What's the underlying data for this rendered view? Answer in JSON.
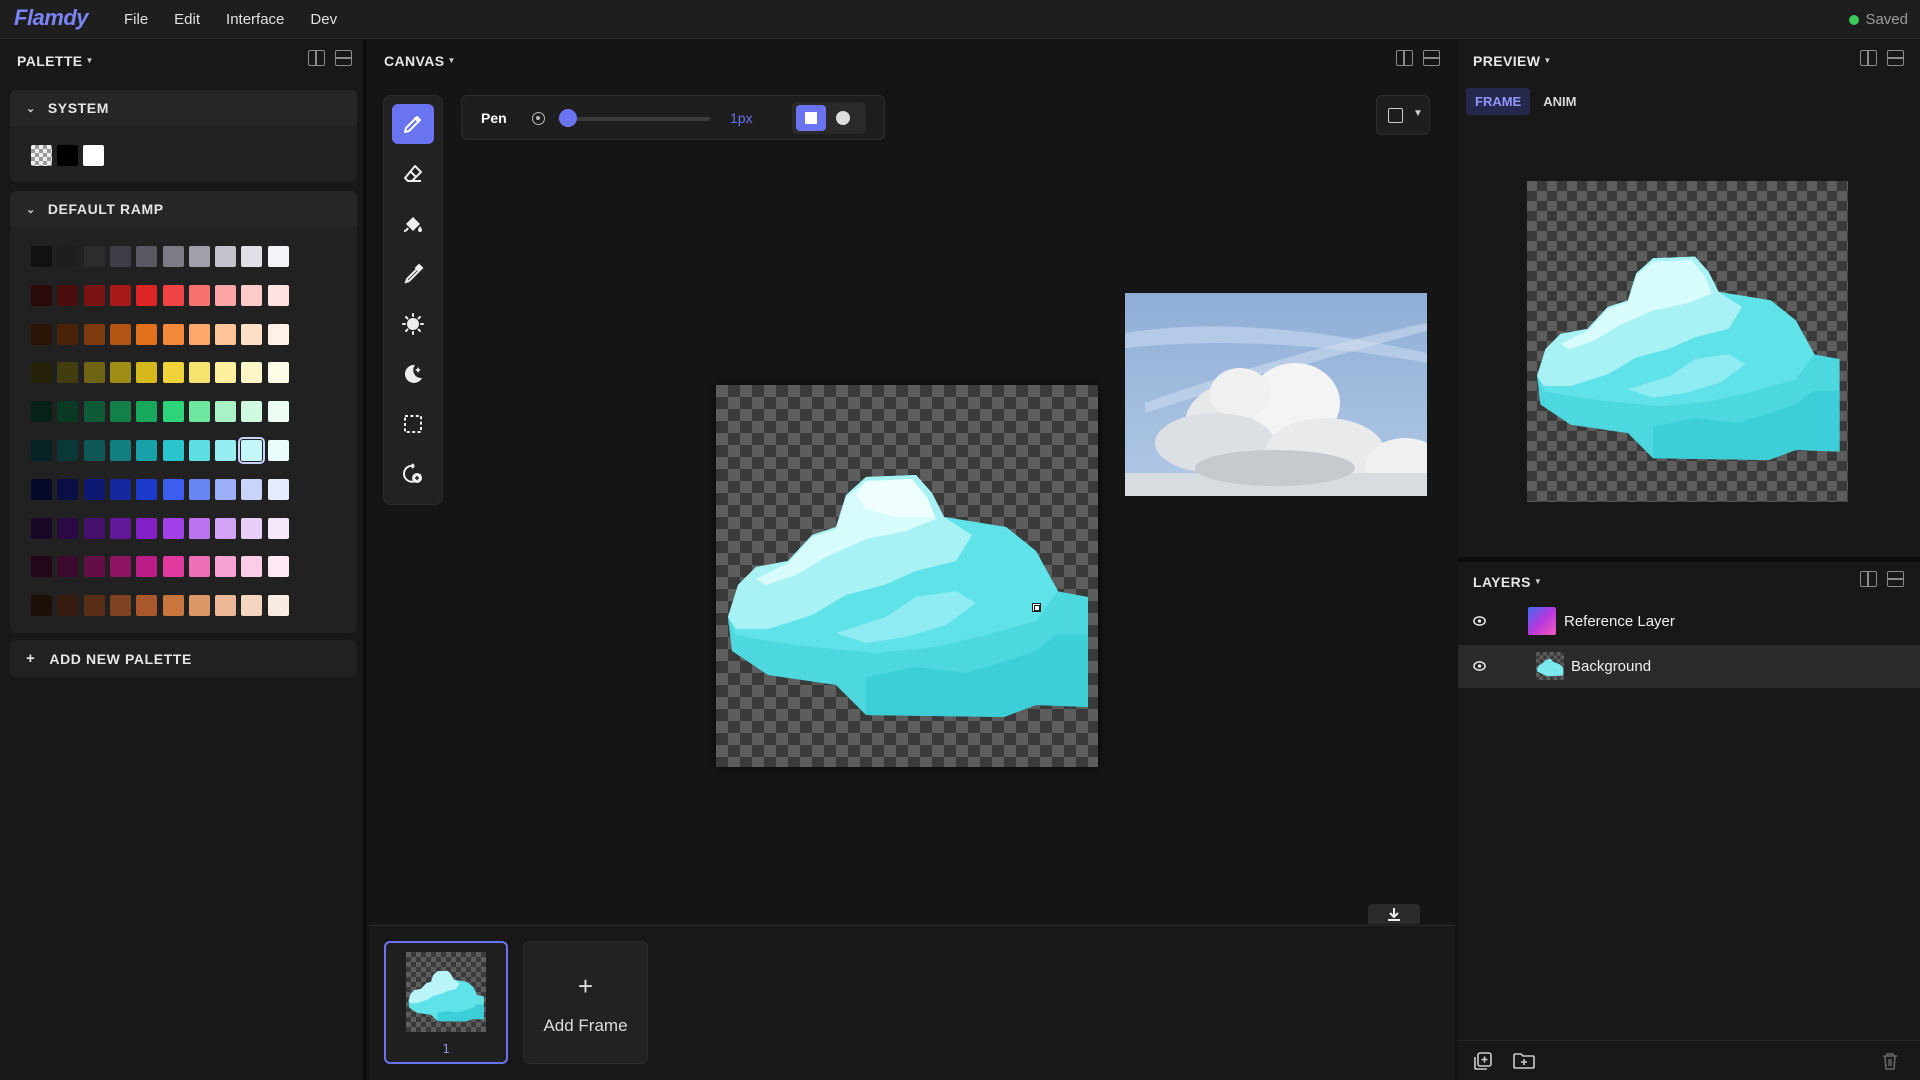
{
  "app": {
    "logo": "Flamdy",
    "menu": [
      "File",
      "Edit",
      "Interface",
      "Dev"
    ],
    "status": "Saved",
    "status_color": "#3bc95a",
    "accent": "#6a74f0"
  },
  "palette_panel": {
    "title": "PALETTE",
    "system": {
      "title": "SYSTEM",
      "colors": [
        "transparent",
        "#000000",
        "#ffffff"
      ]
    },
    "default_ramp": {
      "title": "DEFAULT RAMP",
      "selected": {
        "row": 5,
        "col": 8
      },
      "rows": [
        [
          "#111111",
          "#1e1e1e",
          "#2c2c2c",
          "#3e3e46",
          "#585862",
          "#7c7c86",
          "#a0a0aa",
          "#c2c2cc",
          "#e0e0e8",
          "#f4f4f8"
        ],
        [
          "#2a0a0a",
          "#4a0e0e",
          "#7a1414",
          "#a81a1a",
          "#dc2626",
          "#ef4444",
          "#f87171",
          "#fca5a5",
          "#fecaca",
          "#fee2e2"
        ],
        [
          "#2a1406",
          "#4a2208",
          "#7c3a0e",
          "#b35412",
          "#e0701a",
          "#f5893a",
          "#fba86a",
          "#fdc49a",
          "#fde0c8",
          "#fff1e6"
        ],
        [
          "#26220a",
          "#423c0e",
          "#6e6414",
          "#9e8e18",
          "#d4b81c",
          "#f0d23a",
          "#f8e270",
          "#fcef9e",
          "#fdf6c8",
          "#fefbe6"
        ],
        [
          "#062216",
          "#0a3a24",
          "#0e5a36",
          "#128048",
          "#16a95c",
          "#2ed47a",
          "#6ee7a0",
          "#a7f3c5",
          "#cffae0",
          "#ecfdf3"
        ],
        [
          "#062222",
          "#0a3838",
          "#0e5858",
          "#127e7e",
          "#16a2a8",
          "#28c6cc",
          "#5edde2",
          "#96eef0",
          "#c4f7f8",
          "#e8fcfc"
        ],
        [
          "#06082a",
          "#0a1046",
          "#0e1a72",
          "#1428a0",
          "#1c3acc",
          "#3c5ef0",
          "#6a86f5",
          "#9cb0fa",
          "#c8d4fc",
          "#e6ecfe"
        ],
        [
          "#180626",
          "#2a0a42",
          "#44106c",
          "#621698",
          "#8220c6",
          "#a040e6",
          "#bc72f0",
          "#d4a2f6",
          "#e8cdfa",
          "#f5e8fd"
        ],
        [
          "#22061a",
          "#3c0a2c",
          "#640e48",
          "#8e1466",
          "#bc1c86",
          "#e03a9e",
          "#ee6eb8",
          "#f6a2d2",
          "#fbcde6",
          "#fde8f4"
        ],
        [
          "#1e1008",
          "#361c0e",
          "#582e16",
          "#7e4220",
          "#a8582c",
          "#c8763e",
          "#dc9866",
          "#eab896",
          "#f4d6c0",
          "#fbece2"
        ]
      ]
    },
    "add_label": "ADD NEW PALETTE"
  },
  "canvas_panel": {
    "title": "CANVAS",
    "tools": [
      "pencil-icon",
      "eraser-icon",
      "fill-bucket-icon",
      "eyedropper-icon",
      "lighten-icon",
      "darken-icon",
      "selection-icon",
      "replace-color-icon"
    ],
    "active_tool": "pencil-icon",
    "tool_options": {
      "name": "Pen",
      "size_value": "1px",
      "brush_shape": "square"
    }
  },
  "timeline": {
    "frames": [
      {
        "number": "1"
      }
    ],
    "add_frame_label": "Add Frame"
  },
  "preview_panel": {
    "title": "PREVIEW",
    "tabs": [
      "FRAME",
      "ANIM"
    ],
    "active_tab": "FRAME"
  },
  "layers_panel": {
    "title": "LAYERS",
    "layers": [
      {
        "name": "Reference Layer",
        "visible": true,
        "selected": false
      },
      {
        "name": "Background",
        "visible": true,
        "selected": true
      }
    ]
  }
}
